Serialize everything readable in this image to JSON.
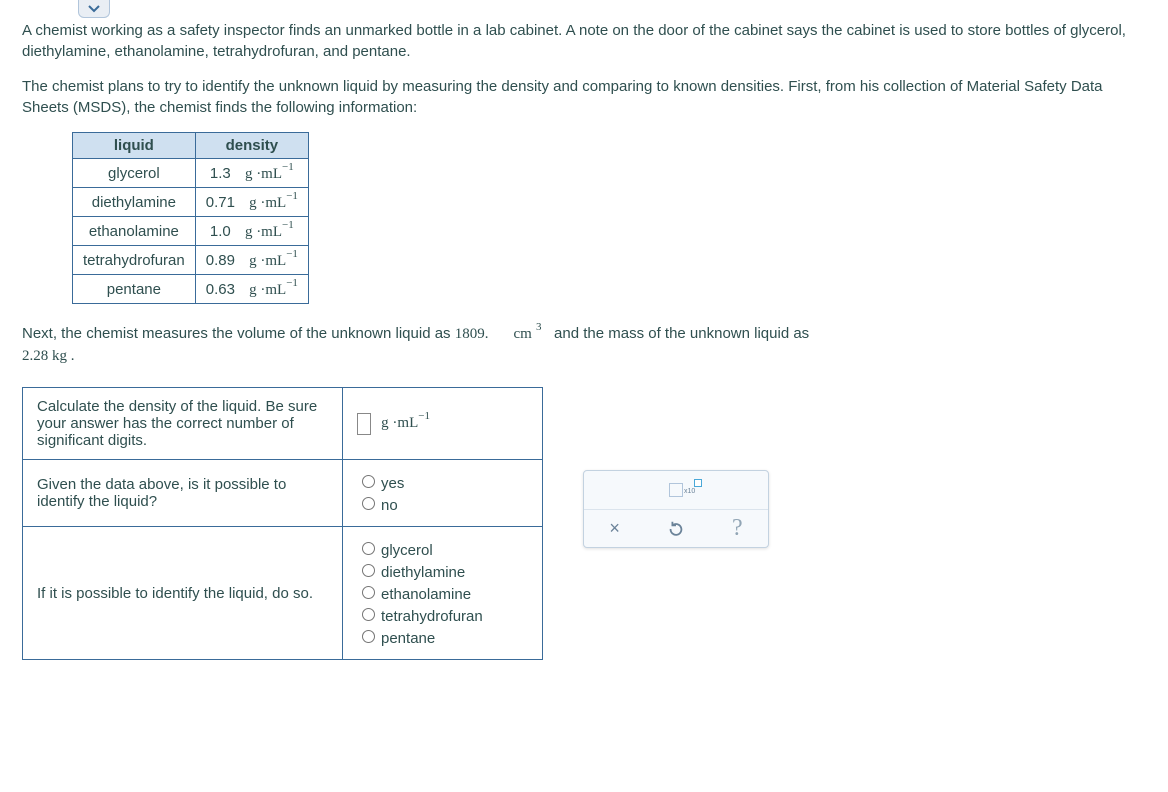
{
  "dropdown_icon": "chevron-down",
  "intro_p1": "A chemist working as a safety inspector finds an unmarked bottle in a lab cabinet. A note on the door of the cabinet says the cabinet is used to store bottles of glycerol, diethylamine, ethanolamine, tetrahydrofuran, and pentane.",
  "intro_p2": "The chemist plans to try to identify the unknown liquid by measuring the density and comparing to known densities. First, from his collection of Material Safety Data Sheets (MSDS), the chemist finds the following information:",
  "table_headers": {
    "liquid": "liquid",
    "density": "density"
  },
  "density_unit_base": "g ·mL",
  "density_exp": "−1",
  "liquids": [
    {
      "name": "glycerol",
      "density": "1.3"
    },
    {
      "name": "diethylamine",
      "density": "0.71"
    },
    {
      "name": "ethanolamine",
      "density": "1.0"
    },
    {
      "name": "tetrahydrofuran",
      "density": "0.89"
    },
    {
      "name": "pentane",
      "density": "0.63"
    }
  ],
  "measure_sentence": {
    "pre": "Next, the chemist measures the volume of the unknown liquid as ",
    "volume": "1809.",
    "cm": "cm",
    "cm_exp": "3",
    "mid": " and the mass of the unknown liquid as",
    "mass_line": "2.28   kg ."
  },
  "questions": {
    "q1": "Calculate the density of the liquid. Be sure your answer has the correct number of significant digits.",
    "q1_unit_base": "g ·mL",
    "q1_exp": "−1",
    "q2": "Given the data above, is it possible to identify the liquid?",
    "q2_opts": {
      "yes": "yes",
      "no": "no"
    },
    "q3": "If it is possible to identify the liquid, do so.",
    "q3_opts": [
      "glycerol",
      "diethylamine",
      "ethanolamine",
      "tetrahydrofuran",
      "pentane"
    ]
  },
  "toolbox": {
    "sci": "x10",
    "close": "×",
    "reset": "↺",
    "help": "?"
  }
}
